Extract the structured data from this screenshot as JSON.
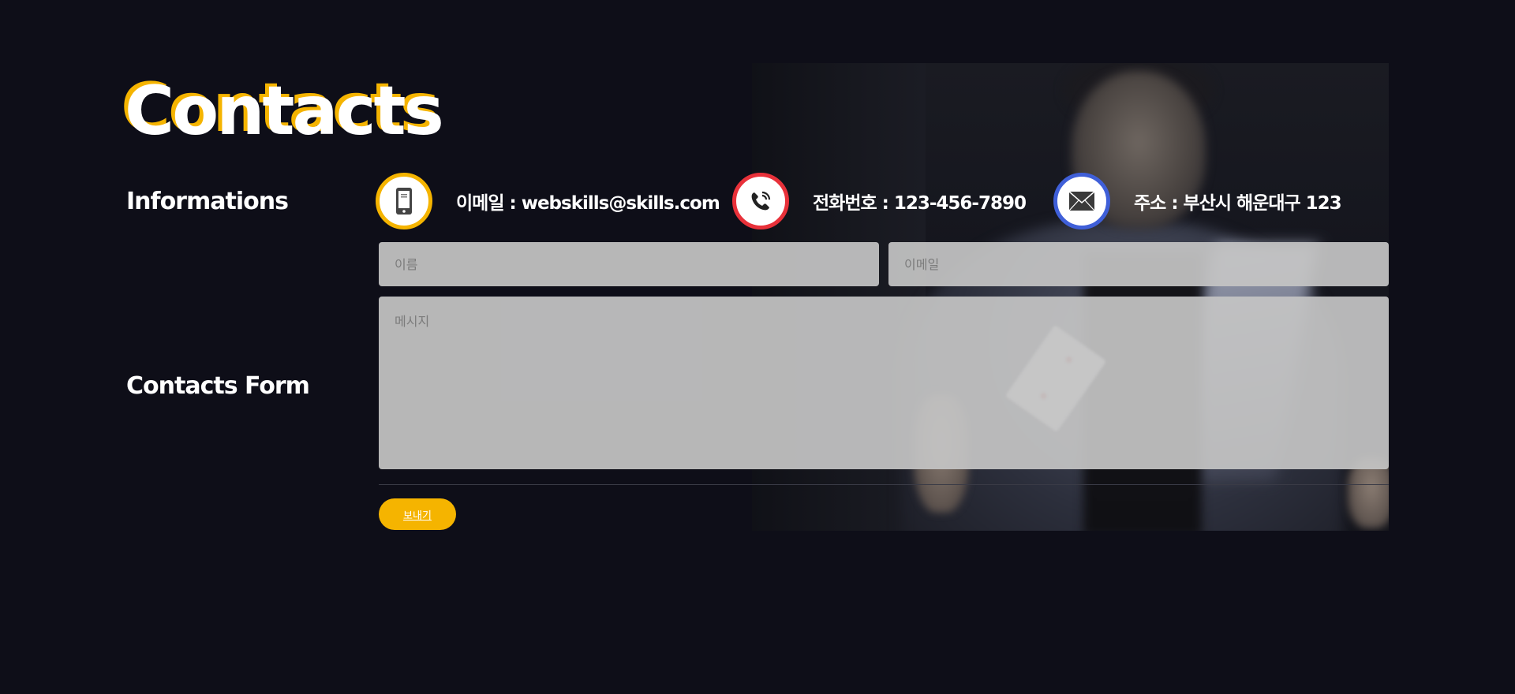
{
  "page": {
    "title": "Contacts"
  },
  "sections": {
    "info_heading": "Informations",
    "form_heading": "Contacts Form"
  },
  "info": {
    "email": {
      "icon": "smartphone-icon",
      "color": "#f5b400",
      "text": "이메일 : webskills@skills.com"
    },
    "phone": {
      "icon": "phone-call-icon",
      "color": "#e8313a",
      "text": "전화번호 : 123-456-7890"
    },
    "address": {
      "icon": "envelope-icon",
      "color": "#3f5fd8",
      "text": "주소 : 부산시 해운대구 123"
    }
  },
  "form": {
    "name_placeholder": "이름",
    "email_placeholder": "이메일",
    "message_placeholder": "메시지",
    "submit_label": "보내기"
  },
  "colors": {
    "background": "#0e0e18",
    "accent": "#f5b400"
  }
}
